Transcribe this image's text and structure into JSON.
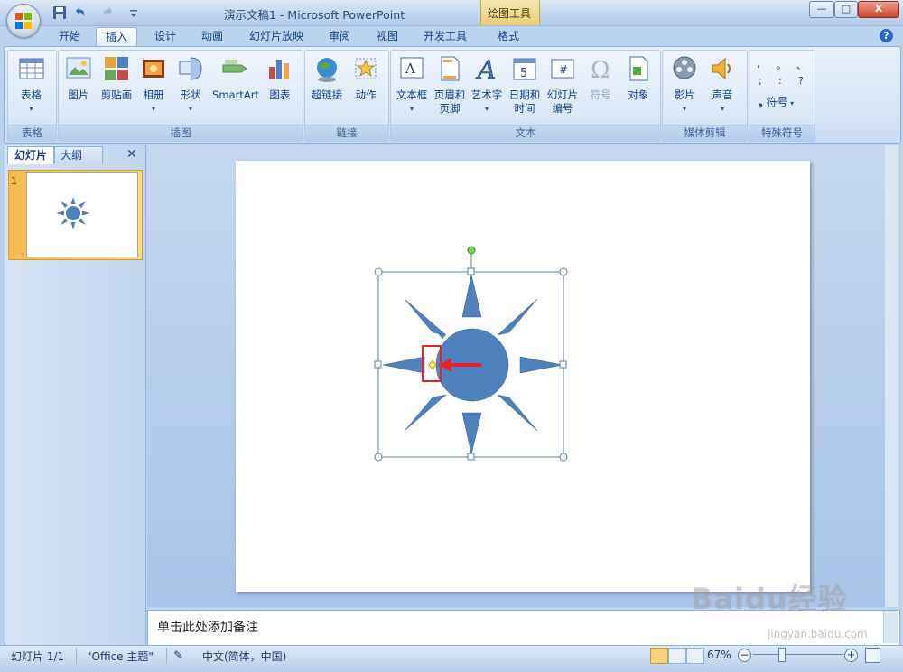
{
  "window": {
    "title": "演示文稿1 - Microsoft PowerPoint",
    "context_tool": "绘图工具",
    "controls": {
      "minimize": "—",
      "maximize": "□",
      "close": "X"
    }
  },
  "tabs": [
    {
      "label": "开始",
      "active": false
    },
    {
      "label": "插入",
      "active": true
    },
    {
      "label": "设计",
      "active": false
    },
    {
      "label": "动画",
      "active": false
    },
    {
      "label": "幻灯片放映",
      "active": false
    },
    {
      "label": "审阅",
      "active": false
    },
    {
      "label": "视图",
      "active": false
    },
    {
      "label": "开发工具",
      "active": false
    },
    {
      "label": "格式",
      "active": false
    }
  ],
  "ribbon": {
    "groups": {
      "tables": "表格",
      "illustrations": "插图",
      "links": "链接",
      "text": "文本",
      "media": "媒体剪辑",
      "symbols": "特殊符号"
    },
    "buttons": {
      "table": "表格",
      "picture": "图片",
      "clipart": "剪贴画",
      "album": "相册",
      "shapes": "形状",
      "smartart": "SmartArt",
      "chart": "图表",
      "hyperlink": "超链接",
      "action": "动作",
      "textbox": "文本框",
      "header_footer_1": "页眉和",
      "header_footer_2": "页脚",
      "wordart": "艺术字",
      "datetime_1": "日期和",
      "datetime_2": "时间",
      "slide_number_1": "幻灯片",
      "slide_number_2": "编号",
      "symbol": "符号",
      "object": "对象",
      "movie": "影片",
      "sound": "声音",
      "symbols_button": "符号"
    },
    "symbol_grid": [
      ",",
      "。",
      "、",
      ";",
      ":",
      "?"
    ]
  },
  "left_pane": {
    "tab_slides": "幻灯片",
    "tab_outline": "大纲",
    "close": "✕",
    "slide_number": "1"
  },
  "notes": {
    "placeholder": "单击此处添加备注"
  },
  "status": {
    "slide": "幻灯片 1/1",
    "theme": "\"Office 主题\"",
    "language": "中文(简体，中国)",
    "zoom": "67%"
  },
  "colors": {
    "shape_fill": "#4f81bd",
    "shape_stroke": "#385d8a",
    "annotation_red": "#e8222a",
    "ribbon_text": "#15428b"
  },
  "watermark": {
    "brand": "Baidu经验",
    "url": "jingyan.baidu.com"
  }
}
